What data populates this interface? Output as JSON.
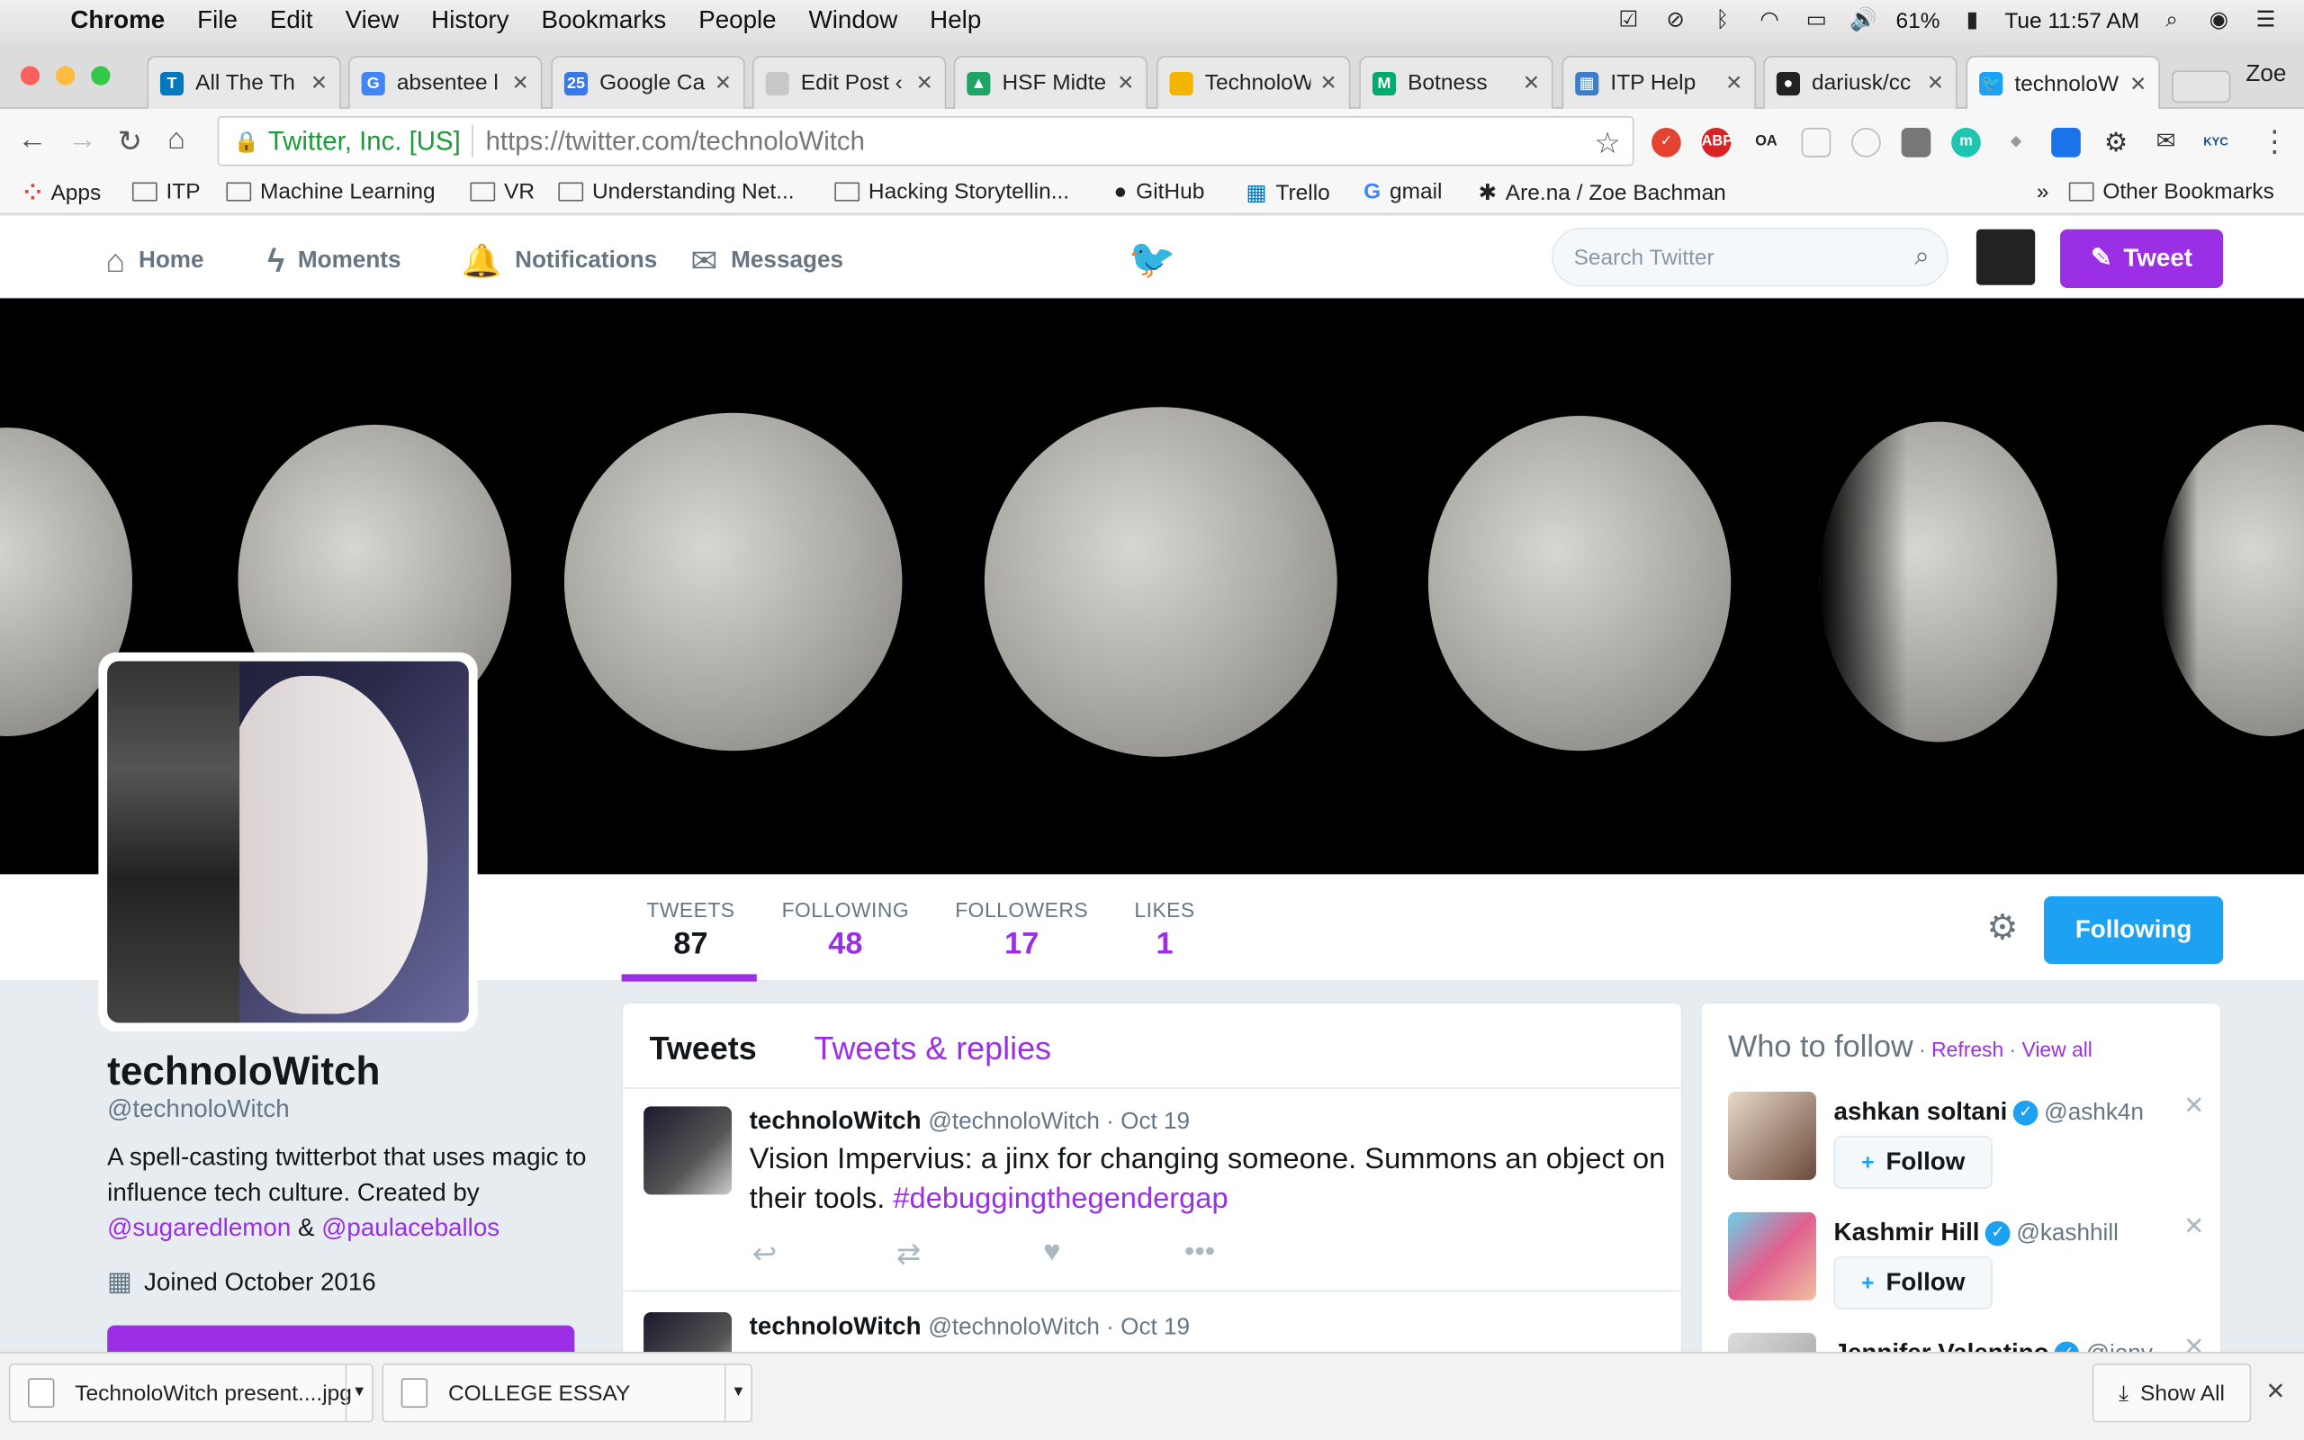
{
  "menubar": {
    "app": "Chrome",
    "items": [
      "File",
      "Edit",
      "View",
      "History",
      "Bookmarks",
      "People",
      "Window",
      "Help"
    ],
    "battery": "61%",
    "clock": "Tue 11:57 AM"
  },
  "tabs": [
    {
      "label": "All The Th",
      "color": "#0079bf",
      "glyph": "T"
    },
    {
      "label": "absentee l",
      "color": "#4285f4",
      "glyph": "G"
    },
    {
      "label": "Google Ca",
      "color": "#3b78e7",
      "glyph": "25"
    },
    {
      "label": "Edit Post ‹",
      "color": "#c8c8c8",
      "glyph": ""
    },
    {
      "label": "HSF Midte",
      "color": "#1fa463",
      "glyph": "▲"
    },
    {
      "label": "TechnoloW",
      "color": "#f4b400",
      "glyph": ""
    },
    {
      "label": "Botness",
      "color": "#00ab6c",
      "glyph": "M"
    },
    {
      "label": "ITP Help",
      "color": "#3d7ec9",
      "glyph": "▦"
    },
    {
      "label": "dariusk/cc",
      "color": "#222222",
      "glyph": "●"
    },
    {
      "label": "technoloW",
      "color": "#1da1f2",
      "glyph": "🐦"
    }
  ],
  "profile_name": "Zoe",
  "omnibox": {
    "ev_name": "Twitter, Inc. [US]",
    "url_scheme_host": "https://twitter.com",
    "url_path": "/technoloWitch"
  },
  "bookmarks": [
    {
      "label": "Apps",
      "type": "apps"
    },
    {
      "label": "ITP",
      "type": "folder"
    },
    {
      "label": "Machine Learning",
      "type": "folder"
    },
    {
      "label": "VR",
      "type": "folder"
    },
    {
      "label": "Understanding Net...",
      "type": "folder"
    },
    {
      "label": "Hacking Storytellin...",
      "type": "folder"
    },
    {
      "label": "GitHub",
      "type": "github"
    },
    {
      "label": "Trello",
      "type": "trello"
    },
    {
      "label": "gmail",
      "type": "google"
    },
    {
      "label": "Are.na / Zoe Bachman",
      "type": "arena"
    }
  ],
  "other_bookmarks": "Other Bookmarks",
  "twnav": {
    "home": "Home",
    "moments": "Moments",
    "notifications": "Notifications",
    "messages": "Messages",
    "search_placeholder": "Search Twitter",
    "tweet_button": "Tweet"
  },
  "stats": {
    "tweets_label": "TWEETS",
    "tweets": "87",
    "following_label": "FOLLOWING",
    "following": "48",
    "followers_label": "FOLLOWERS",
    "followers": "17",
    "likes_label": "LIKES",
    "likes": "1"
  },
  "following_button": "Following",
  "profile": {
    "name": "technoloWitch",
    "handle": "@technoloWitch",
    "bio_text": "A spell-casting twitterbot that uses magic to influence tech culture. Created by ",
    "bio_link1": "@sugaredlemon",
    "bio_amp": " & ",
    "bio_link2": "@paulaceballos",
    "joined": "Joined October 2016"
  },
  "timeline": {
    "tab_tweets": "Tweets",
    "tab_replies": "Tweets & replies",
    "tweets": [
      {
        "name": "technoloWitch",
        "meta": "@technoloWitch · Oct 19",
        "text": "Vision Impervius: a jinx for changing someone. Summons an object on their tools. ",
        "hashtag": "#debuggingthegendergap"
      },
      {
        "name": "technoloWitch",
        "meta": "@technoloWitch · Oct 19",
        "text": "",
        "hashtag": ""
      }
    ]
  },
  "who_to_follow": {
    "title": "Who to follow",
    "refresh": "Refresh",
    "view_all": "View all",
    "follow_label": "Follow",
    "users": [
      {
        "name": "ashkan soltani",
        "handle": "@ashk4n",
        "verified": true
      },
      {
        "name": "Kashmir Hill",
        "handle": "@kashhill",
        "verified": true
      },
      {
        "name": "Jennifer Valentino",
        "handle": "@jenv",
        "verified": true
      }
    ]
  },
  "downloads": [
    {
      "label": "TechnoloWitch present....jpg"
    },
    {
      "label": "COLLEGE ESSAY"
    }
  ],
  "show_all": "Show All"
}
